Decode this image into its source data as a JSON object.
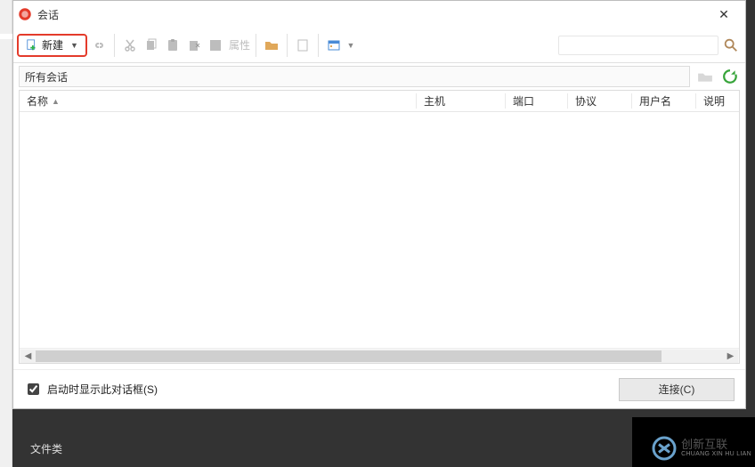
{
  "window": {
    "title": "会话"
  },
  "toolbar": {
    "new_label": "新建",
    "properties_label": "属性"
  },
  "breadcrumb": {
    "path": "所有会话"
  },
  "table": {
    "headers": {
      "name": "名称",
      "host": "主机",
      "port": "端口",
      "protocol": "协议",
      "user": "用户名",
      "desc": "说明"
    }
  },
  "footer": {
    "show_on_start_label": "启动时显示此对话框(S)",
    "show_on_start_checked": true,
    "connect_label": "连接(C)"
  },
  "background": {
    "file_category": "文件类"
  },
  "brand": {
    "zh": "创新互联",
    "en": "CHUANG XIN HU LIAN"
  }
}
